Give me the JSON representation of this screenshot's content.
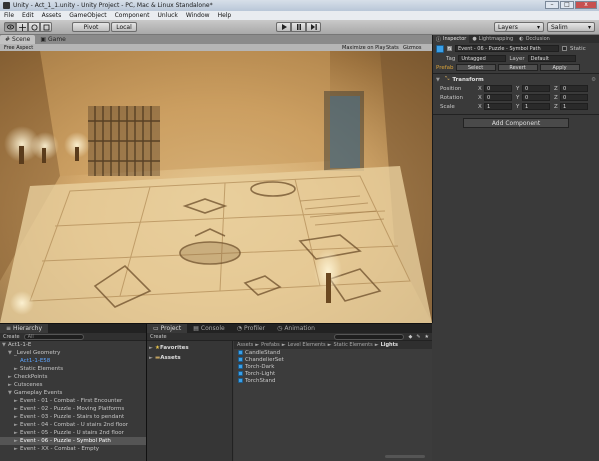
{
  "window": {
    "title": "Unity - Act_1_1.unity - Unity Project - PC, Mac & Linux Standalone*",
    "controls": [
      "–",
      "□",
      "x"
    ]
  },
  "menu": [
    "File",
    "Edit",
    "Assets",
    "GameObject",
    "Component",
    "Unluck",
    "Window",
    "Help"
  ],
  "toolbar": {
    "pivot": "Pivot",
    "local": "Local",
    "layers": "Layers",
    "layout": "Salim"
  },
  "scene_panel": {
    "tabs": [
      "Scene",
      "Game"
    ],
    "aspect": "Free Aspect",
    "options": [
      "Maximize on Play",
      "Stats",
      "Gizmos"
    ]
  },
  "inspector": {
    "tabs": [
      "Inspector",
      "Lightmapping",
      "Occlusion"
    ],
    "object_name": "Event - 06 - Puzzle - Symbol Path",
    "static_label": "Static",
    "tag_label": "Tag",
    "tag_value": "Untagged",
    "layer_label": "Layer",
    "layer_value": "Default",
    "prefab_label": "Prefab",
    "prefab_buttons": [
      "Select",
      "Revert",
      "Apply"
    ],
    "component": "Transform",
    "transform": [
      {
        "label": "Position",
        "x": "0",
        "y": "0",
        "z": "0"
      },
      {
        "label": "Rotation",
        "x": "0",
        "y": "0",
        "z": "0"
      },
      {
        "label": "Scale",
        "x": "1",
        "y": "1",
        "z": "1"
      }
    ],
    "add_component": "Add Component"
  },
  "hierarchy": {
    "tab": "Hierarchy",
    "create": "Create",
    "search_placeholder": "All",
    "items": [
      {
        "label": "Act1-1-E",
        "indent": 0,
        "arrow": "▼",
        "style": "normal"
      },
      {
        "label": "_Level Geometry",
        "indent": 1,
        "arrow": "▼",
        "style": "normal"
      },
      {
        "label": "Act1-1-E58",
        "indent": 2,
        "arrow": "",
        "style": "prefab"
      },
      {
        "label": "Static Elements",
        "indent": 2,
        "arrow": "►",
        "style": "normal"
      },
      {
        "label": "CheckPoints",
        "indent": 1,
        "arrow": "►",
        "style": "normal"
      },
      {
        "label": "Cutscenes",
        "indent": 1,
        "arrow": "►",
        "style": "normal"
      },
      {
        "label": "Gameplay Events",
        "indent": 1,
        "arrow": "▼",
        "style": "normal"
      },
      {
        "label": "Event - 01 - Combat - First Encounter",
        "indent": 2,
        "arrow": "►",
        "style": "normal"
      },
      {
        "label": "Event - 02 - Puzzle - Moving Platforms",
        "indent": 2,
        "arrow": "►",
        "style": "normal"
      },
      {
        "label": "Event - 03 - Puzzle - Stairs to pendant",
        "indent": 2,
        "arrow": "►",
        "style": "normal"
      },
      {
        "label": "Event - 04 - Combat - U stairs 2nd floor",
        "indent": 2,
        "arrow": "►",
        "style": "normal"
      },
      {
        "label": "Event - 05 - Puzzle - U stairs 2nd floor",
        "indent": 2,
        "arrow": "►",
        "style": "normal"
      },
      {
        "label": "Event - 06 - Puzzle - Symbol Path",
        "indent": 2,
        "arrow": "►",
        "style": "selected"
      },
      {
        "label": "Event - XX - Combat - Empty",
        "indent": 2,
        "arrow": "►",
        "style": "normal"
      }
    ]
  },
  "project": {
    "tabs": [
      "Project",
      "Console",
      "Profiler",
      "Animation"
    ],
    "create": "Create",
    "favorites": "Favorites",
    "assets": "Assets",
    "breadcrumb": [
      "Assets",
      "Prefabs",
      "Level Elements",
      "Static Elements"
    ],
    "breadcrumb_current": "Lights",
    "items": [
      "CandleStand",
      "ChandelierSet",
      "Torch-Dark",
      "Torch-Light",
      "TorchStand"
    ]
  },
  "colors": {
    "accent_blue": "#3aa0e8",
    "selection": "#555555",
    "prefab_text": "#5ea5ff"
  }
}
